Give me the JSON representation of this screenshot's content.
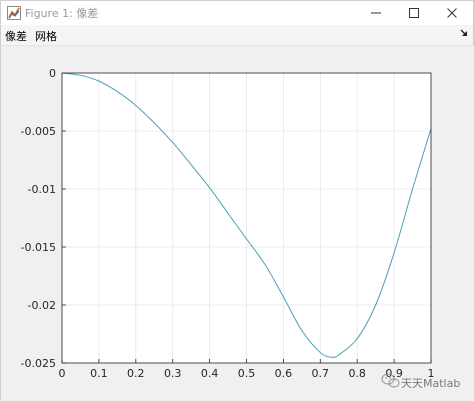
{
  "window": {
    "title": "Figure 1: 像差",
    "menu": [
      "像差",
      "网格"
    ],
    "icons": {
      "app": "matlab-figure-icon",
      "minimize": "minimize-icon",
      "maximize": "maximize-icon",
      "close": "close-icon",
      "dock": "dock-arrow-icon"
    }
  },
  "watermark": "天天Matlab",
  "chart_data": {
    "type": "line",
    "grid": true,
    "xlim": [
      0,
      1
    ],
    "ylim": [
      -0.025,
      0
    ],
    "xticks": [
      "0",
      "0.1",
      "0.2",
      "0.3",
      "0.4",
      "0.5",
      "0.6",
      "0.7",
      "0.8",
      "0.9",
      "1"
    ],
    "yticks": [
      "0",
      "-0.005",
      "-0.01",
      "-0.015",
      "-0.02",
      "-0.025"
    ],
    "series": [
      {
        "color": "#4aa1b1",
        "x": [
          0,
          0.05,
          0.1,
          0.15,
          0.2,
          0.25,
          0.3,
          0.35,
          0.4,
          0.45,
          0.5,
          0.55,
          0.6,
          0.65,
          0.7,
          0.73,
          0.75,
          0.8,
          0.85,
          0.9,
          0.95,
          1
        ],
        "y": [
          0,
          -0.0002,
          -0.0007,
          -0.0016,
          -0.0028,
          -0.0043,
          -0.006,
          -0.0079,
          -0.0099,
          -0.0121,
          -0.0143,
          -0.0165,
          -0.0193,
          -0.0222,
          -0.0241,
          -0.0245,
          -0.0243,
          -0.0229,
          -0.02,
          -0.0155,
          -0.01,
          -0.0048
        ]
      }
    ]
  }
}
